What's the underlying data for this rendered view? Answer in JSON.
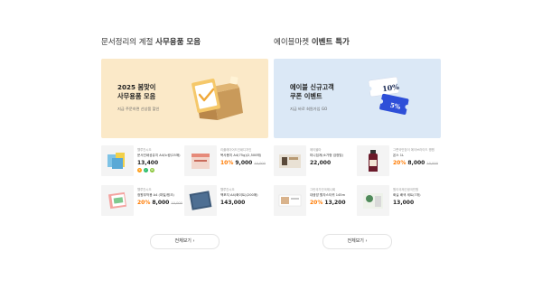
{
  "sections": [
    {
      "title_light": "문서정리의 계절",
      "title_bold": "사무용품 모음",
      "banner": {
        "title": "2025 봄맞이\n사무용품 모음",
        "subtitle": "지금 주문하면 선상품 할인"
      },
      "products": [
        {
          "brand": "웰루칸시오",
          "name": "문서인쇄공유지 A4/노랑(25매)",
          "discount": "",
          "price": "13,400",
          "original": ""
        },
        {
          "brand": "리플레이어드인쇄디자인",
          "name": "복사용지 A4(75g)(2,500매)",
          "discount": "10%",
          "price": "9,000",
          "original": "10,000"
        },
        {
          "brand": "웰루칸시오",
          "name": "정원부착용 A4 (파일/핑크)",
          "discount": "20%",
          "price": "8,000",
          "original": "10,000"
        },
        {
          "brand": "웰루칸시오",
          "name": "책포지 A4(화이트)(200매)",
          "discount": "",
          "price": "143,000",
          "original": ""
        }
      ],
      "more_label": "전체보기 ›"
    },
    {
      "title_light": "에이블마켓",
      "title_bold": "이벤트 특가",
      "banner": {
        "title": "에이블 신규고객\n쿠폰 이벤트",
        "subtitle": "지금 바로 회원가입 GO",
        "coupon_top": "10%",
        "coupon_bottom": "5%"
      },
      "products": [
        {
          "brand": "에이블마",
          "name": "미니집게(소가형 검정빛)",
          "discount": "",
          "price": "22,000",
          "original": ""
        },
        {
          "brand": "그릇국민장이 에이브라이드 병원",
          "name": "온스 1L",
          "discount": "20%",
          "price": "8,000",
          "original": "10,000"
        },
        {
          "brand": "그린국가건국제니회",
          "name": "대광방 활자스티퀴 145m",
          "discount": "20%",
          "price": "13,200",
          "original": ""
        },
        {
          "brand": "원이국제선생국민원",
          "name": "화실 배색 세트(7개)",
          "discount": "",
          "price": "13,000",
          "original": ""
        }
      ],
      "more_label": "전체보기 ›"
    }
  ],
  "colors": {
    "banner_left": "#fbe9c8",
    "banner_right": "#dbe8f6",
    "discount": "#ff7a00",
    "coupon": "#2e4fd8"
  }
}
